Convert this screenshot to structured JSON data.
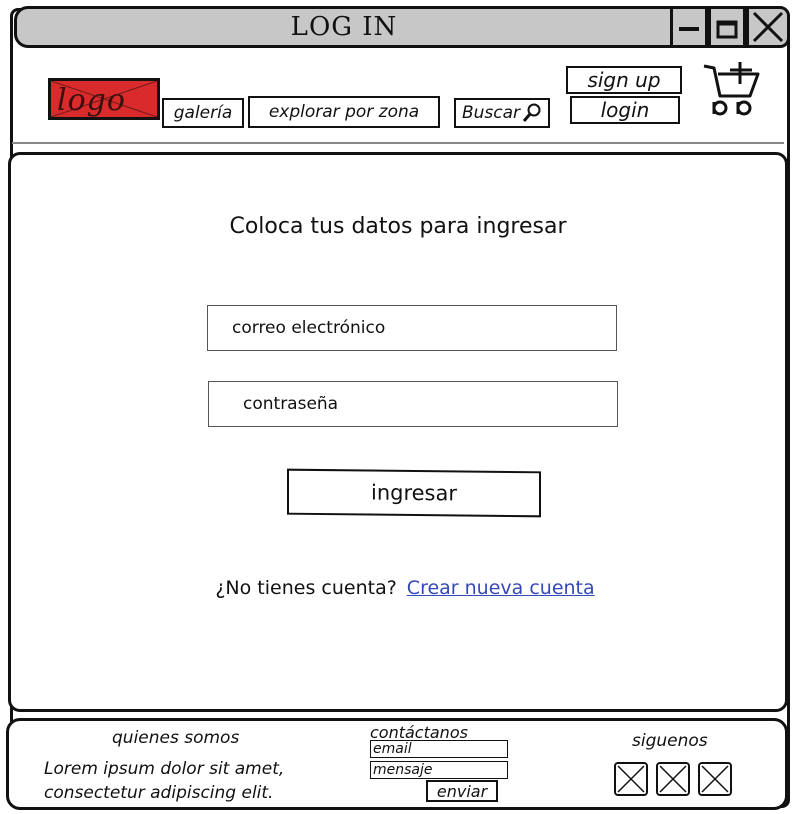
{
  "window": {
    "title": "LOG IN"
  },
  "header": {
    "logo_text": "logo",
    "nav": {
      "gallery": "galería",
      "explore": "explorar por zona",
      "search": "Buscar"
    },
    "signup_label": "sign up",
    "login_label": "login"
  },
  "login": {
    "title": "Coloca tus datos para ingresar",
    "email_placeholder": "correo electrónico",
    "password_placeholder": "contraseña",
    "submit_label": "ingresar",
    "no_account": "¿No tienes cuenta?",
    "create_account": "Crear nueva cuenta"
  },
  "footer": {
    "about_title": "quienes somos",
    "about_body": "Lorem ipsum dolor sit amet, consectetur adipiscing elit.",
    "contact_title": "contáctanos",
    "email_label": "email",
    "message_label": "mensaje",
    "send_label": "enviar",
    "follow_title": "siguenos"
  },
  "icons": {
    "minimize": "minimize-icon",
    "maximize": "maximize-icon",
    "close": "close-icon",
    "search": "search-icon",
    "cart": "cart-icon",
    "social": [
      "social-placeholder-icon",
      "social-placeholder-icon",
      "social-placeholder-icon"
    ]
  },
  "colors": {
    "titlebar": "#c7c7c7",
    "logo": "#d92b2b",
    "link": "#3548b8"
  }
}
